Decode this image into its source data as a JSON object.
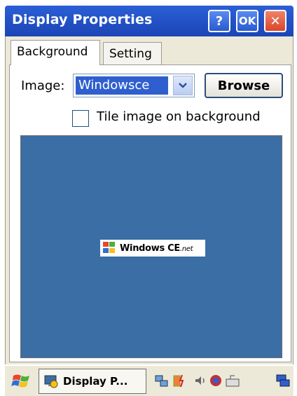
{
  "window": {
    "title": "Display Properties",
    "help_label": "?",
    "ok_label": "OK",
    "close_label": "✕"
  },
  "tabs": [
    {
      "label": "Background",
      "selected": true
    },
    {
      "label": "Setting",
      "selected": false
    }
  ],
  "background_tab": {
    "image_label": "Image:",
    "image_value": "Windowsce",
    "browse_label": "Browse",
    "tile_label": "Tile image on background",
    "tile_checked": false
  },
  "preview": {
    "logo_text": "Windows CE",
    "logo_suffix": ".net",
    "background_color": "#3a6ea5"
  },
  "taskbar": {
    "task_label": "Display P...",
    "tray_icons": [
      "network-icon",
      "battery-icon",
      "volume-icon",
      "sync-icon",
      "keyboard-icon"
    ],
    "desktop_icon": "desktop-icon"
  }
}
